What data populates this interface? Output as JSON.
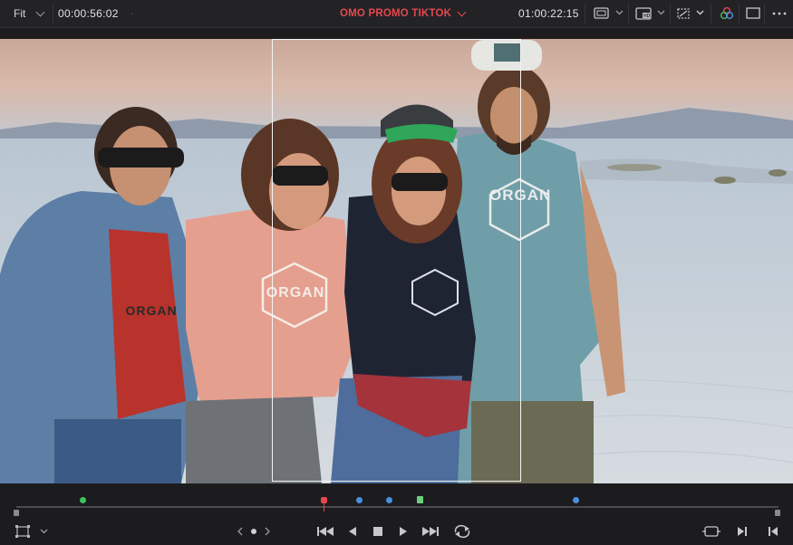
{
  "toolbar": {
    "fit_label": "Fit",
    "source_timecode": "00:00:56:02",
    "timeline_title": "OMO PROMO TIKTOK",
    "record_timecode": "01:00:22:15"
  },
  "icons": {
    "viewer_mode": "monitor-icon",
    "quality": "hd-icon",
    "overlay": "transform-overlay-icon",
    "color": "color-wheel-icon",
    "layout": "single-viewer-icon",
    "more": "more-options-icon",
    "crop": "crop-icon",
    "prev_clip": "jump-to-start-icon",
    "play_reverse": "play-reverse-icon",
    "stop": "stop-icon",
    "play": "play-icon",
    "next_clip": "jump-to-end-icon",
    "loop": "loop-icon",
    "match_frame": "match-frame-icon",
    "next_edit": "next-edit-icon",
    "prev_edit": "previous-edit-icon"
  },
  "viewer": {
    "shirt_text": "ORGAN"
  },
  "colors": {
    "accent_red": "#e5484d",
    "marker_green": "#3ec45b",
    "marker_blue": "#4a8fe0",
    "in_out_green": "#6fce7c"
  }
}
